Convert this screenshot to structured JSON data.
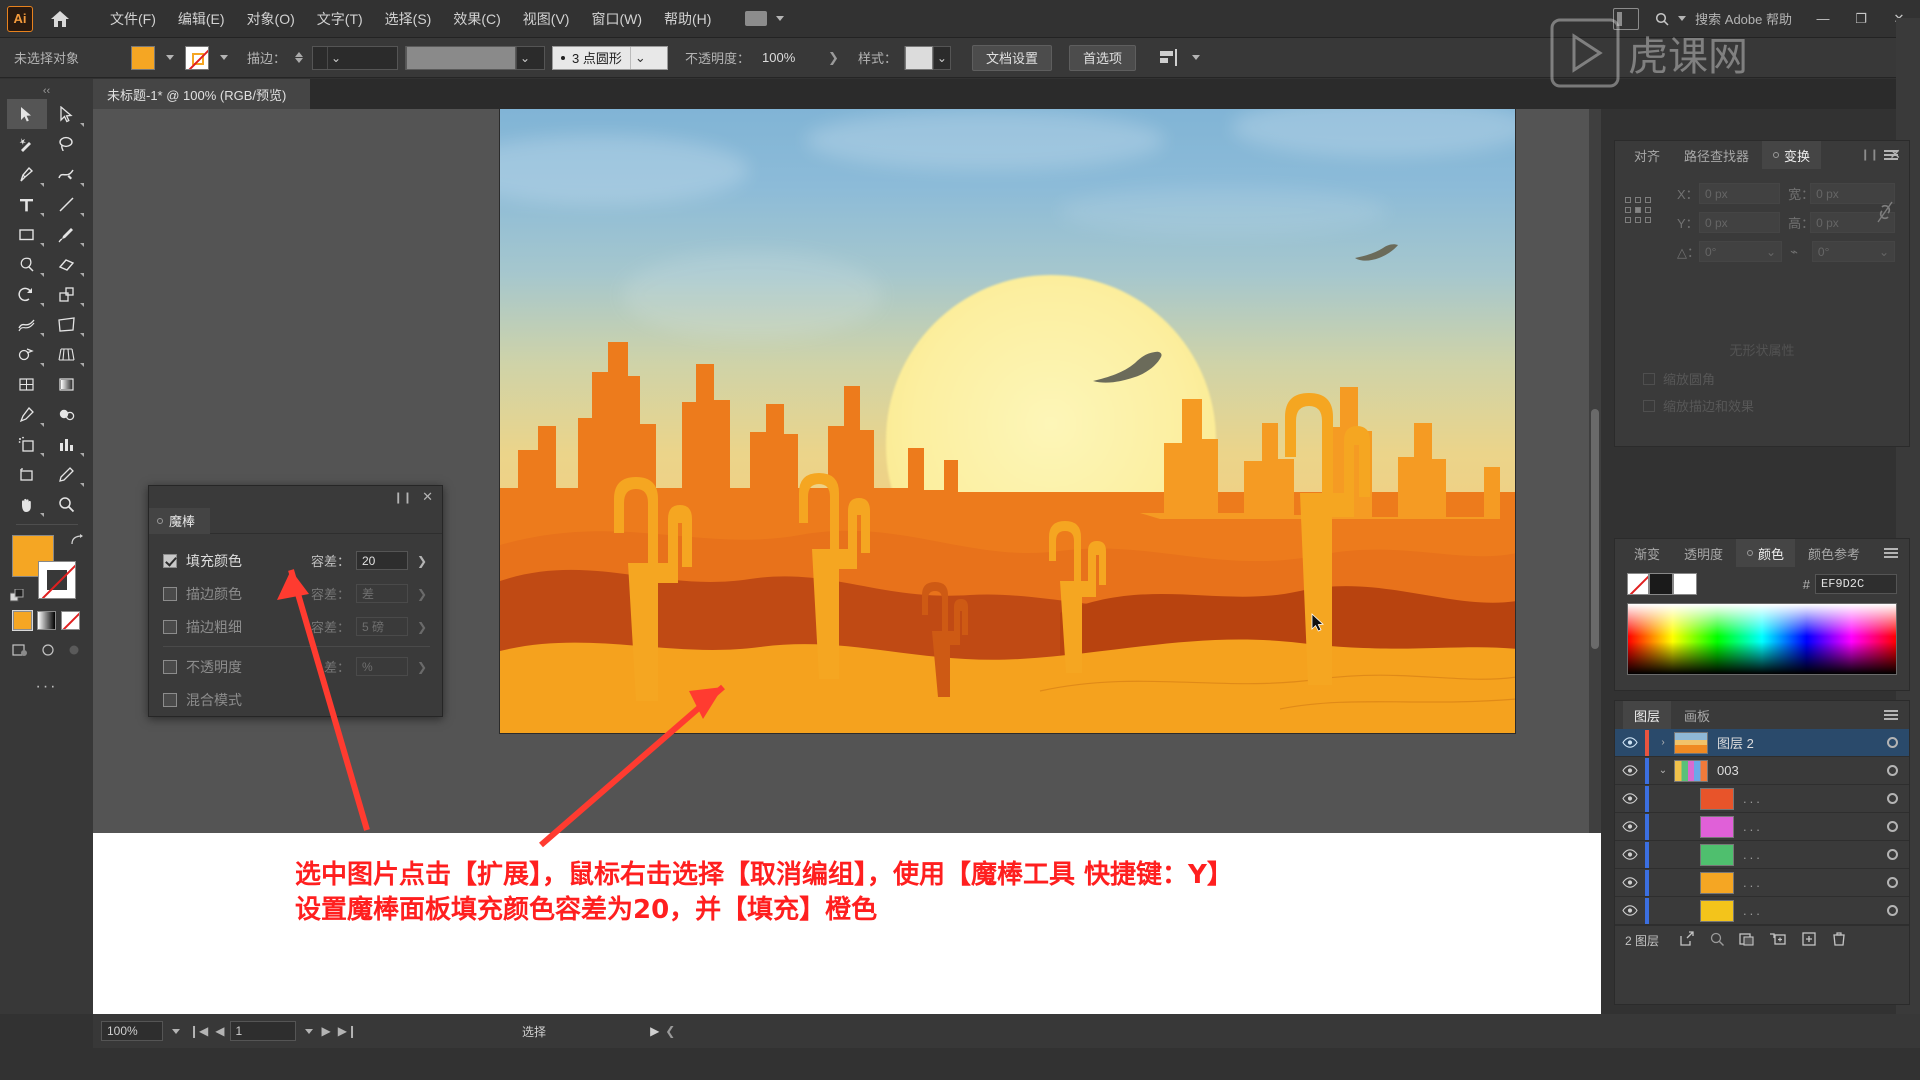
{
  "app": {
    "name": "Adobe Illustrator",
    "logo_text": "Ai",
    "home_icon": "home-icon"
  },
  "menubar": {
    "items": [
      {
        "label": "文件(F)"
      },
      {
        "label": "编辑(E)"
      },
      {
        "label": "对象(O)"
      },
      {
        "label": "文字(T)"
      },
      {
        "label": "选择(S)"
      },
      {
        "label": "效果(C)"
      },
      {
        "label": "视图(V)"
      },
      {
        "label": "窗口(W)"
      },
      {
        "label": "帮助(H)"
      }
    ],
    "workspace_switcher": "workspace-switcher",
    "search_placeholder": "搜索 Adobe 帮助",
    "window_buttons": [
      "—",
      "❐",
      "✕"
    ]
  },
  "controlbar": {
    "selection_status": "未选择对象",
    "fill_color": "#F5A623",
    "stroke_color": "none",
    "stroke_label": "描边：",
    "stroke_weight": "",
    "variable_width_profile": "",
    "brush_definition": "3 点圆形",
    "opacity_label": "不透明度：",
    "opacity_value": "100%",
    "style_label": "样式：",
    "doc_setup_button": "文档设置",
    "preferences_button": "首选项",
    "align_icon": "align-icon"
  },
  "tab": {
    "title": "未标题-1* @ 100% (RGB/预览)",
    "close_icon": "close-icon"
  },
  "toolbar": {
    "tools": [
      {
        "name": "selection-tool",
        "glyph": "▶",
        "active": true
      },
      {
        "name": "direct-selection-tool",
        "glyph": "▷",
        "active": false
      },
      {
        "name": "magic-wand-tool",
        "glyph": "✦",
        "active": false
      },
      {
        "name": "lasso-tool",
        "glyph": "◌",
        "active": false
      },
      {
        "name": "pen-tool",
        "glyph": "✒",
        "active": false
      },
      {
        "name": "curvature-tool",
        "glyph": "∿",
        "active": false
      },
      {
        "name": "type-tool",
        "glyph": "T",
        "active": false
      },
      {
        "name": "line-segment-tool",
        "glyph": "╱",
        "active": false
      },
      {
        "name": "rectangle-tool",
        "glyph": "▭",
        "active": false
      },
      {
        "name": "paintbrush-tool",
        "glyph": "🖌",
        "active": false
      },
      {
        "name": "shaper-tool",
        "glyph": "◯",
        "active": false
      },
      {
        "name": "eraser-tool",
        "glyph": "◇",
        "active": false
      },
      {
        "name": "rotate-tool",
        "glyph": "↺",
        "active": false
      },
      {
        "name": "scale-tool",
        "glyph": "⤡",
        "active": false
      },
      {
        "name": "width-tool",
        "glyph": "≋",
        "active": false
      },
      {
        "name": "free-transform-tool",
        "glyph": "⬚",
        "active": false
      },
      {
        "name": "shape-builder-tool",
        "glyph": "⊕",
        "active": false
      },
      {
        "name": "perspective-grid-tool",
        "glyph": "▦",
        "active": false
      },
      {
        "name": "mesh-tool",
        "glyph": "▩",
        "active": false
      },
      {
        "name": "gradient-tool",
        "glyph": "▤",
        "active": false
      },
      {
        "name": "eyedropper-tool",
        "glyph": "⚲",
        "active": false
      },
      {
        "name": "blend-tool",
        "glyph": "◕",
        "active": false
      },
      {
        "name": "symbol-sprayer-tool",
        "glyph": "⁙",
        "active": false
      },
      {
        "name": "column-graph-tool",
        "glyph": "▥",
        "active": false
      },
      {
        "name": "artboard-tool",
        "glyph": "⬓",
        "active": false
      },
      {
        "name": "slice-tool",
        "glyph": "✎",
        "active": false
      },
      {
        "name": "hand-tool",
        "glyph": "✋",
        "active": false
      },
      {
        "name": "zoom-tool",
        "glyph": "🔍",
        "active": false
      }
    ],
    "fill_swatch": "#F5A623",
    "stroke_swatch": "none",
    "swap-icon": "swap-fill-stroke-icon",
    "default-icon": "default-fill-stroke-icon",
    "paint_modes": [
      "color-mode",
      "gradient-mode",
      "none-mode"
    ],
    "screen_modes": [
      "screen-mode-normal",
      "screen-mode-full",
      "screen-mode-presentation"
    ],
    "more_tools": "···"
  },
  "magic_wand_panel": {
    "tab_label": "魔棒",
    "close_icon": "close-icon",
    "collapse_icon": "collapse-icon",
    "rows": [
      {
        "label": "填充颜色",
        "checked": true,
        "tol_label": "容差：",
        "tol_value": "20",
        "enabled": true
      },
      {
        "label": "描边颜色",
        "checked": false,
        "tol_label": "容差：",
        "tol_value": "差",
        "enabled": false
      },
      {
        "label": "描边粗细",
        "checked": false,
        "tol_label": "容差：",
        "tol_value": "5 磅",
        "enabled": false
      },
      {
        "label": "不透明度",
        "checked": false,
        "tol_label": "差：",
        "tol_value": "%",
        "enabled": false
      },
      {
        "label": "混合模式",
        "checked": false,
        "tol_label": "",
        "tol_value": "",
        "enabled": false
      }
    ]
  },
  "transform_panel": {
    "tabs": [
      {
        "label": "对齐",
        "active": false
      },
      {
        "label": "路径查找器",
        "active": false
      },
      {
        "label": "变换",
        "active": true
      }
    ],
    "x_label": "X：",
    "x_value": "0 px",
    "y_label": "Y：",
    "y_value": "0 px",
    "w_label": "宽：",
    "w_value": "0 px",
    "h_label": "高：",
    "h_value": "0 px",
    "angle_label": "△：",
    "angle_value": "0°",
    "shear_label": "0°",
    "shear_value": "0°",
    "no_properties": "无形状属性",
    "checks": [
      {
        "label": "缩放圆角"
      },
      {
        "label": "缩放描边和效果"
      }
    ],
    "lock_icon": "link-proportions-icon",
    "reference_point": "reference-point-grid",
    "menu_icon": "panel-menu-icon",
    "close_icon": "close-icon"
  },
  "color_panel": {
    "tabs": [
      {
        "label": "渐变",
        "active": false
      },
      {
        "label": "透明度",
        "active": false
      },
      {
        "label": "颜色",
        "active": true
      },
      {
        "label": "颜色参考",
        "active": false
      }
    ],
    "hex_prefix": "#",
    "hex_value": "EF9D2C",
    "none_swatch": "none-swatch",
    "fill_swatch": "#1A1A1A",
    "stroke_swatch": "#FFFFFF",
    "menu_icon": "panel-menu-icon"
  },
  "layers_panel": {
    "tabs": [
      {
        "label": "图层",
        "active": true
      },
      {
        "label": "画板",
        "active": false
      }
    ],
    "menu_icon": "panel-menu-icon",
    "rows": [
      {
        "name": "图层 2",
        "selected": true,
        "indent": 0,
        "color": "#E8543F",
        "thumb": "artwork",
        "expand": "›",
        "eye": true
      },
      {
        "name": "003",
        "selected": false,
        "indent": 0,
        "color": "#3B6FE0",
        "thumb": "group",
        "expand": "⌄",
        "eye": true
      },
      {
        "name": "...",
        "selected": false,
        "indent": 1,
        "color": "#3B6FE0",
        "thumb": "#E8542A",
        "expand": "",
        "eye": true
      },
      {
        "name": "...",
        "selected": false,
        "indent": 1,
        "color": "#3B6FE0",
        "thumb": "#E060D8",
        "expand": "",
        "eye": true
      },
      {
        "name": "...",
        "selected": false,
        "indent": 1,
        "color": "#3B6FE0",
        "thumb": "#4FBF6E",
        "expand": "",
        "eye": true
      },
      {
        "name": "...",
        "selected": false,
        "indent": 1,
        "color": "#3B6FE0",
        "thumb": "#F5A623",
        "expand": "",
        "eye": true
      },
      {
        "name": "...",
        "selected": false,
        "indent": 1,
        "color": "#3B6FE0",
        "thumb": "#F3C41B",
        "expand": "",
        "eye": true
      }
    ],
    "footer_count": "2 图层",
    "footer_icons": [
      "locate-object-icon",
      "search-icon",
      "make-clipping-mask-icon",
      "new-sublayer-icon",
      "new-layer-icon",
      "delete-layer-icon"
    ]
  },
  "annotation": {
    "line1": "选中图片点击【扩展】，鼠标右击选择【取消编组】，使用【魔棒工具 快捷键：Y】",
    "line2": "设置魔棒面板填充颜色容差为20，并【填充】橙色",
    "color": "#FF1F1F"
  },
  "statusbar": {
    "zoom": "100%",
    "page": "1",
    "status_text": "选择",
    "first_icon": "first-page-icon",
    "prev_icon": "prev-page-icon",
    "next_icon": "next-page-icon",
    "last_icon": "last-page-icon"
  },
  "artwork": {
    "title": "desert-sunset-illustration",
    "sky_top": "#7FB3D5",
    "sky_mid": "#EBD48A",
    "sun_color": "#FDF6B8",
    "sand_color": "#F5A21E",
    "rock_color": "#ED7B1C",
    "shadow_color": "#C04A14"
  }
}
